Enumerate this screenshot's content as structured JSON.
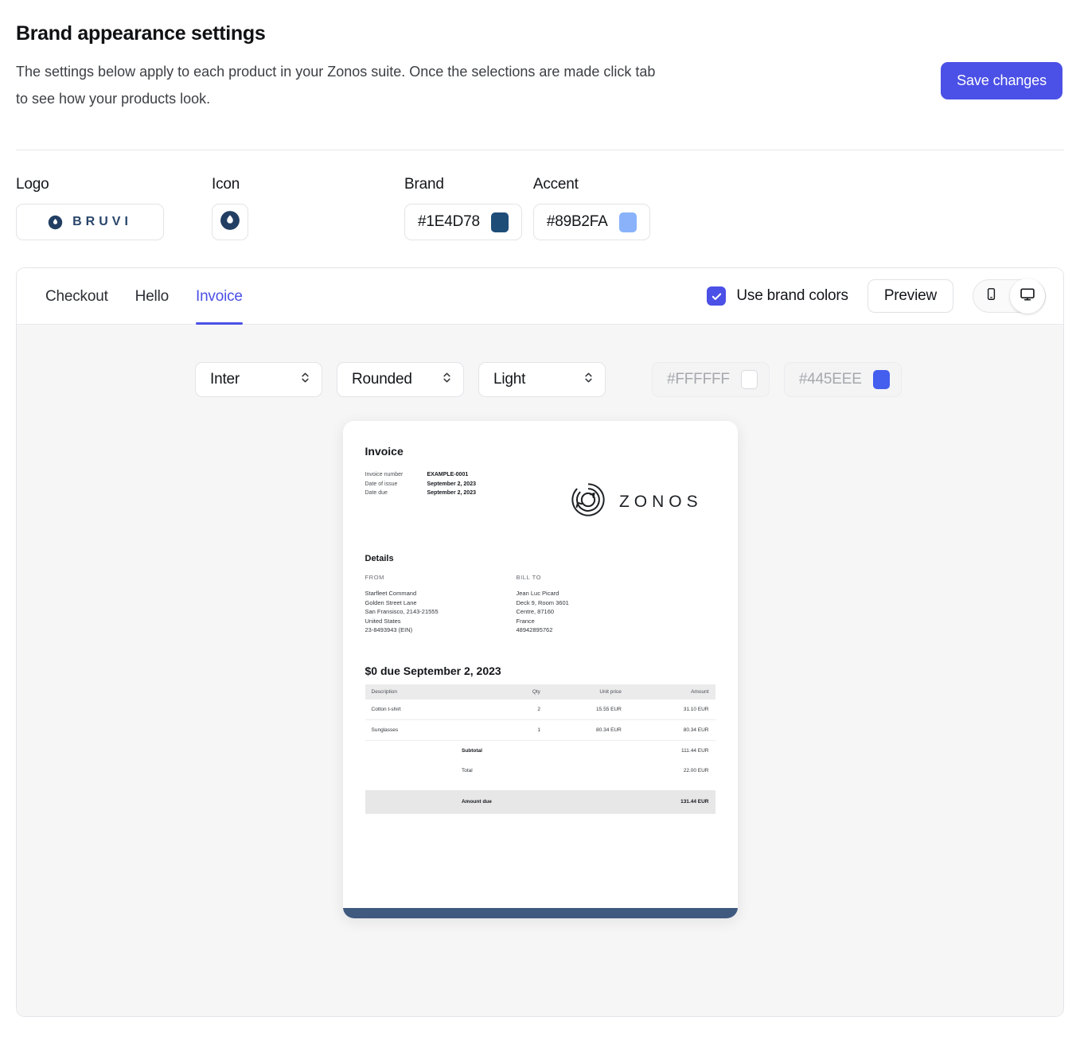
{
  "header": {
    "title": "Brand appearance settings",
    "description": "The settings below apply to each product in your Zonos suite. Once the selections are made click tab to see how your products look.",
    "save_label": "Save changes",
    "save_color": "#4B50E6"
  },
  "brand_fields": {
    "logo_label": "Logo",
    "logo_text": "BRUVI",
    "icon_label": "Icon",
    "brand_label": "Brand",
    "brand_hex": "#1E4D78",
    "accent_label": "Accent",
    "accent_hex": "#89B2FA"
  },
  "preview_panel": {
    "tabs": [
      {
        "label": "Checkout",
        "active": false
      },
      {
        "label": "Hello",
        "active": false
      },
      {
        "label": "Invoice",
        "active": true
      }
    ],
    "use_brand_colors_label": "Use brand colors",
    "use_brand_colors_checked": true,
    "preview_label": "Preview",
    "devices": [
      {
        "name": "mobile-device-option",
        "selected": false
      },
      {
        "name": "desktop-device-option",
        "selected": true
      }
    ],
    "controls": {
      "font_value": "Inter",
      "corner_value": "Rounded",
      "theme_value": "Light",
      "background_hex": "#FFFFFF",
      "primary_hex": "#445EEE"
    }
  },
  "invoice": {
    "title": "Invoice",
    "meta": [
      {
        "key": "Invoice number",
        "value": "EXAMPLE-0001"
      },
      {
        "key": "Date of issue",
        "value": "September 2, 2023"
      },
      {
        "key": "Date due",
        "value": "September 2, 2023"
      }
    ],
    "logo_word": "ZONOS",
    "details_heading": "Details",
    "from_heading": "FROM",
    "from_lines": [
      "Starfleet Command",
      "Golden Street Lane",
      "San Fransisco, 2143-21555",
      "United States",
      "23-8493943 (EIN)"
    ],
    "bill_to_heading": "BILL TO",
    "bill_to_lines": [
      "Jean Luc Picard",
      "Deck 9, Room 3601",
      "Centre, 87160",
      "France",
      "48942895762"
    ],
    "due_line": "$0 due September 2, 2023",
    "table": {
      "headers": [
        "Description",
        "Qty",
        "Unit price",
        "Amount"
      ],
      "rows": [
        {
          "description": "Cotton t-shirt",
          "qty": "2",
          "unit_price": "15.55 EUR",
          "amount": "31.10 EUR"
        },
        {
          "description": "Sunglasses",
          "qty": "1",
          "unit_price": "80.34 EUR",
          "amount": "80.34 EUR"
        }
      ],
      "subtotal_label": "Subtotal",
      "subtotal_value": "111.44 EUR",
      "total_label": "Total",
      "total_value": "22.00 EUR",
      "amount_due_label": "Amount due",
      "amount_due_value": "131.44 EUR"
    },
    "footer_bar_color": "#3F5A7E"
  }
}
